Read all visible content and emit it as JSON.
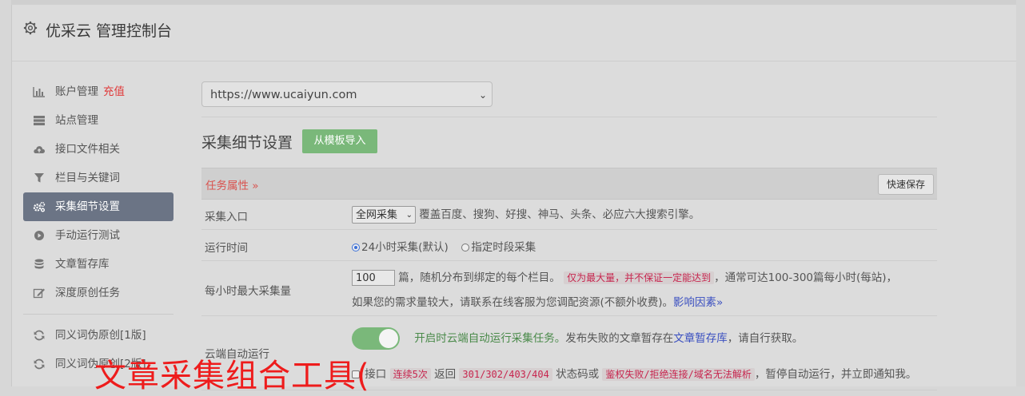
{
  "header": {
    "title": "优采云 管理控制台",
    "icon": "gear-icon"
  },
  "sidebar": {
    "items": [
      {
        "label": "账户管理",
        "extra": "充值",
        "icon": "bar-chart-icon"
      },
      {
        "label": "站点管理",
        "icon": "server-icon"
      },
      {
        "label": "接口文件相关",
        "icon": "cloud-upload-icon"
      },
      {
        "label": "栏目与关键词",
        "icon": "filter-icon"
      },
      {
        "label": "采集细节设置",
        "icon": "gears-icon",
        "active": true
      },
      {
        "label": "手动运行测试",
        "icon": "play-circle-icon"
      },
      {
        "label": "文章暂存库",
        "icon": "database-icon"
      },
      {
        "label": "深度原创任务",
        "icon": "edit-icon"
      }
    ],
    "items2": [
      {
        "label": "同义词伪原创[1版]",
        "icon": "refresh-icon"
      },
      {
        "label": "同义词伪原创[2版]",
        "icon": "refresh-icon"
      }
    ]
  },
  "main": {
    "site_select": "https://www.ucaiyun.com",
    "section_title": "采集细节设置",
    "import_button": "从模板导入",
    "task_props_label": "任务属性 »",
    "quick_save": "快速保存",
    "rows": {
      "entry": {
        "label": "采集入口",
        "select": "全网采集",
        "desc": "覆盖百度、搜狗、好搜、神马、头条、必应六大搜索引擎。"
      },
      "runtime": {
        "label": "运行时间",
        "opt1": "24小时采集(默认)",
        "opt2": "指定时段采集"
      },
      "maxhour": {
        "label": "每小时最大采集量",
        "value": "100",
        "text1": "篇，随机分布到绑定的每个栏目。",
        "warn": "仅为最大量，并不保证一定能达到",
        "text2": "，通常可达100-300篇每小时(每站)，",
        "line2": "如果您的需求量较大，请联系在线客服为您调配资源(不额外收费)。",
        "link": "影响因素»"
      },
      "cloud": {
        "label": "云端自动运行",
        "green_text": "开启时云端自动运行采集任务。",
        "text1": "发布失败的文章暂存在",
        "link": "文章暂存库",
        "text2": "，请自行获取。",
        "line2_prefix": "接口",
        "code1": "连续5次",
        "mid1": "返回",
        "code2": "301/302/403/404",
        "mid2": "状态码或",
        "code3": "鉴权失败/拒绝连接/域名无法解析",
        "tail": "，暂停自动运行，并立即通知我。"
      }
    }
  },
  "overlay_text": "文章采集组合工具(",
  "colors": {
    "active_bg": "#6b7485",
    "accent_green": "#7ab87a",
    "warn_red": "#c7254e",
    "overlay_red": "#ee1c1c"
  }
}
